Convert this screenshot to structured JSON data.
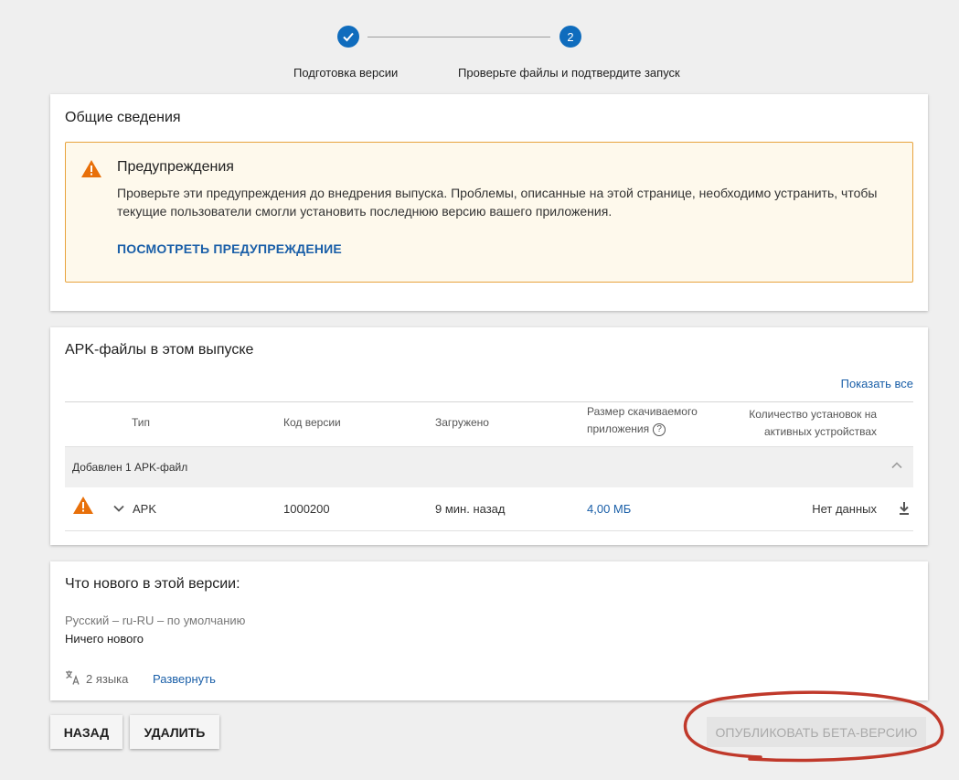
{
  "stepper": {
    "step1_label": "Подготовка версии",
    "step2_number": "2",
    "step2_label": "Проверьте файлы и подтвердите запуск"
  },
  "summary": {
    "title": "Общие сведения",
    "warning": {
      "title": "Предупреждения",
      "text": "Проверьте эти предупреждения до внедрения выпуска. Проблемы, описанные на этой странице, необходимо устранить, чтобы текущие пользователи смогли установить последнюю версию вашего приложения.",
      "link": "ПОСМОТРЕТЬ ПРЕДУПРЕЖДЕНИЕ"
    }
  },
  "apk": {
    "title": "APK-файлы в этом выпуске",
    "show_all": "Показать все",
    "columns": {
      "type": "Тип",
      "version_code": "Код версии",
      "uploaded": "Загружено",
      "size_line1": "Размер скачиваемого",
      "size_line2": "приложения",
      "installs_line1": "Количество установок на",
      "installs_line2": "активных устройствах"
    },
    "group_label": "Добавлен 1 APK-файл",
    "row": {
      "type": "APK",
      "version_code": "1000200",
      "uploaded": "9 мин. назад",
      "size": "4,00 МБ",
      "installs": "Нет данных"
    }
  },
  "whats_new": {
    "title": "Что нового в этой версии:",
    "language": "Русский – ru-RU – по умолчанию",
    "text": "Ничего нового",
    "lang_count": "2 языка",
    "expand": "Развернуть"
  },
  "buttons": {
    "back": "Назад",
    "delete": "Удалить",
    "publish": "ОПУБЛИКОВАТЬ БЕТА-ВЕРСИЮ"
  },
  "colors": {
    "accent": "#0f6cbd",
    "link": "#1a5fa8",
    "warning": "#e8700a",
    "annotation": "#c0392b"
  }
}
